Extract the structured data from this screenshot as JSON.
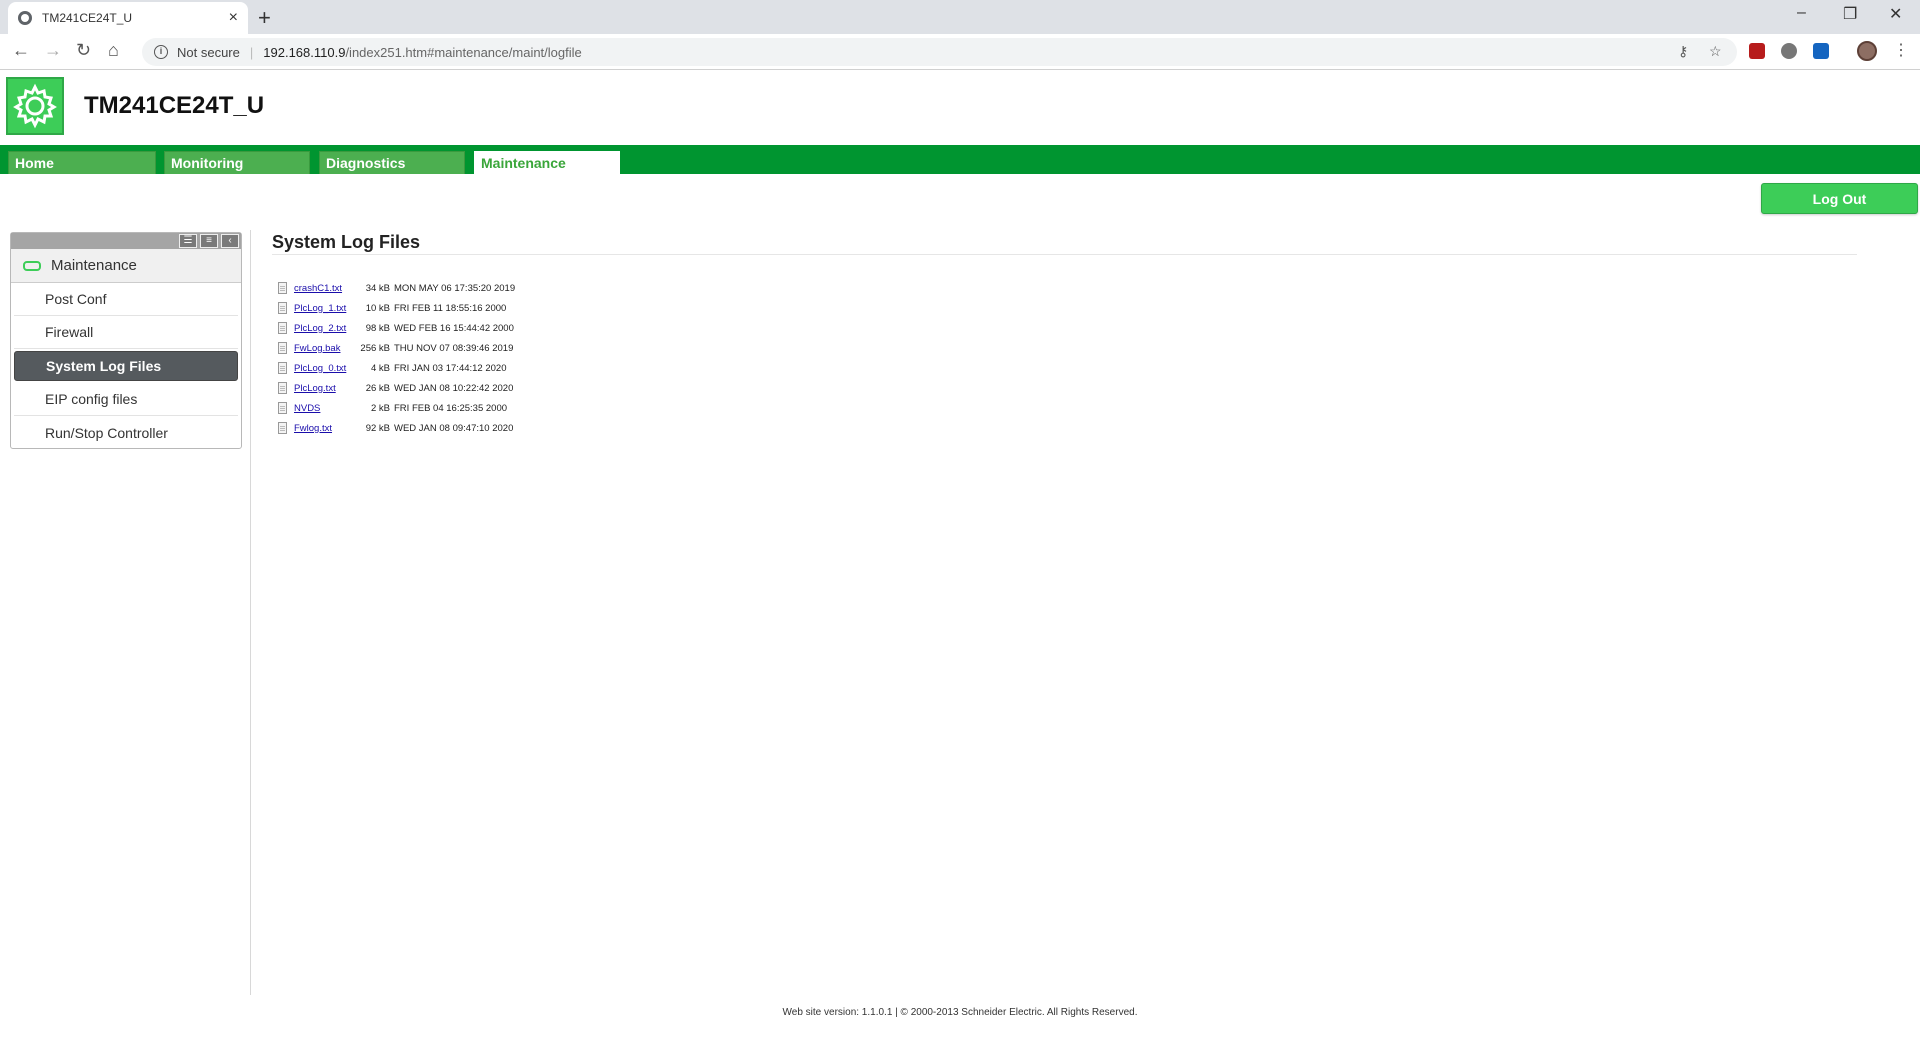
{
  "browser": {
    "tab_title": "TM241CE24T_U",
    "tab_close": "×",
    "new_tab": "+",
    "win_min": "–",
    "win_restore": "❐",
    "win_close": "✕",
    "back": "←",
    "forward": "→",
    "reload": "↻",
    "home": "⌂",
    "info": "i",
    "not_secure": "Not secure",
    "separator": "|",
    "url_host": "192.168.110.9",
    "url_path": "/index251.htm#maintenance/maint/logfile",
    "key_icon": "⚷",
    "star_icon": "☆",
    "kebab": "⋮"
  },
  "header": {
    "device_name": "TM241CE24T_U"
  },
  "nav": {
    "tabs": [
      {
        "label": "Home"
      },
      {
        "label": "Monitoring"
      },
      {
        "label": "Diagnostics"
      },
      {
        "label": "Maintenance",
        "active": true
      }
    ],
    "logout_label": "Log Out"
  },
  "sidebar": {
    "section_label": "Maintenance",
    "header_buttons": [
      "☰",
      "≡",
      "‹"
    ],
    "items": [
      {
        "label": "Post Conf"
      },
      {
        "label": "Firewall"
      },
      {
        "label": "System Log Files",
        "active": true
      },
      {
        "label": "EIP config files"
      },
      {
        "label": "Run/Stop Controller"
      }
    ]
  },
  "main": {
    "title": "System Log Files",
    "files": [
      {
        "name": "crashC1.txt",
        "size": "34 kB",
        "date": "MON MAY 06 17:35:20 2019"
      },
      {
        "name": "PlcLog_1.txt",
        "size": "10 kB",
        "date": "FRI FEB 11 18:55:16 2000"
      },
      {
        "name": "PlcLog_2.txt",
        "size": "98 kB",
        "date": "WED FEB 16 15:44:42 2000"
      },
      {
        "name": "FwLog.bak",
        "size": "256 kB",
        "date": "THU NOV 07 08:39:46 2019"
      },
      {
        "name": "PlcLog_0.txt",
        "size": "4 kB",
        "date": "FRI JAN 03 17:44:12 2020"
      },
      {
        "name": "PlcLog.txt",
        "size": "26 kB",
        "date": "WED JAN 08 10:22:42 2020"
      },
      {
        "name": "NVDS",
        "size": "2 kB",
        "date": "FRI FEB 04 16:25:35 2000"
      },
      {
        "name": "Fwlog.txt",
        "size": "92 kB",
        "date": "WED JAN 08 09:47:10 2020"
      }
    ]
  },
  "footer": {
    "text": "Web site version: 1.1.0.1   |   © 2000-2013 Schneider Electric. All Rights Reserved."
  },
  "colors": {
    "brand_green": "#3dcd58",
    "nav_green": "#009530",
    "sidebar_active": "#555a5e",
    "link": "#1a0dab"
  }
}
